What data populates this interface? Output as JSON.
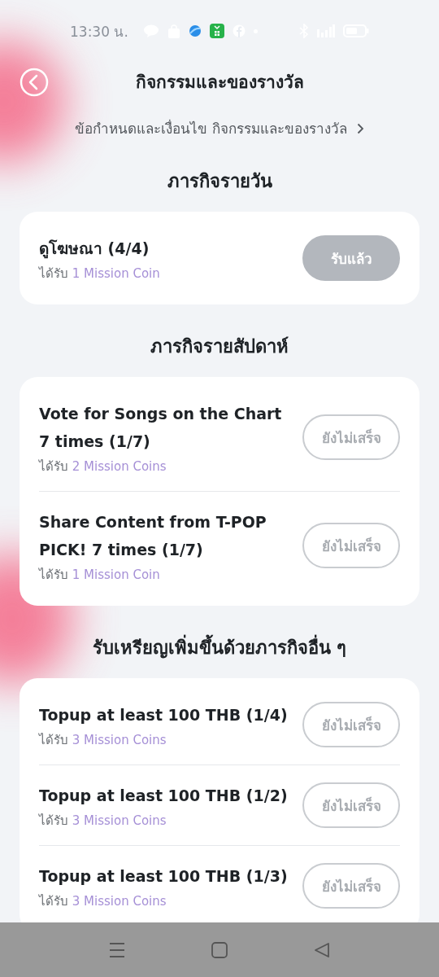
{
  "status_bar": {
    "time": "13:30 น."
  },
  "header": {
    "title": "กิจกรรมและของรางวัล",
    "terms_link": "ข้อกำหนดและเงื่อนไข กิจกรรมและของรางวัล"
  },
  "sections": [
    {
      "title": "ภารกิจรายวัน",
      "missions": [
        {
          "title": "ดูโฆษณา (4/4)",
          "reward_prefix": "ได้รับ",
          "reward": "1 Mission Coin",
          "button": {
            "label": "รับแล้ว",
            "claimed": true
          }
        }
      ]
    },
    {
      "title": "ภารกิจรายสัปดาห์",
      "missions": [
        {
          "title": "Vote for Songs on the Chart 7 times (1/7)",
          "reward_prefix": "ได้รับ",
          "reward": "2 Mission Coins",
          "button": {
            "label": "ยังไม่เสร็จ",
            "claimed": false
          }
        },
        {
          "title": "Share Content from T-POP PICK! 7 times (1/7)",
          "reward_prefix": "ได้รับ",
          "reward": "1 Mission Coin",
          "button": {
            "label": "ยังไม่เสร็จ",
            "claimed": false
          }
        }
      ]
    },
    {
      "title": "รับเหรียญเพิ่มขึ้นด้วยภารกิจอื่น ๆ",
      "missions": [
        {
          "title": "Topup at least 100 THB (1/4)",
          "reward_prefix": "ได้รับ",
          "reward": "3 Mission Coins",
          "button": {
            "label": "ยังไม่เสร็จ",
            "claimed": false
          }
        },
        {
          "title": "Topup at least 100 THB (1/2)",
          "reward_prefix": "ได้รับ",
          "reward": "3 Mission Coins",
          "button": {
            "label": "ยังไม่เสร็จ",
            "claimed": false
          }
        },
        {
          "title": "Topup at least 100 THB (1/3)",
          "reward_prefix": "ได้รับ",
          "reward": "3 Mission Coins",
          "button": {
            "label": "ยังไม่เสร็จ",
            "claimed": false
          }
        }
      ]
    }
  ]
}
